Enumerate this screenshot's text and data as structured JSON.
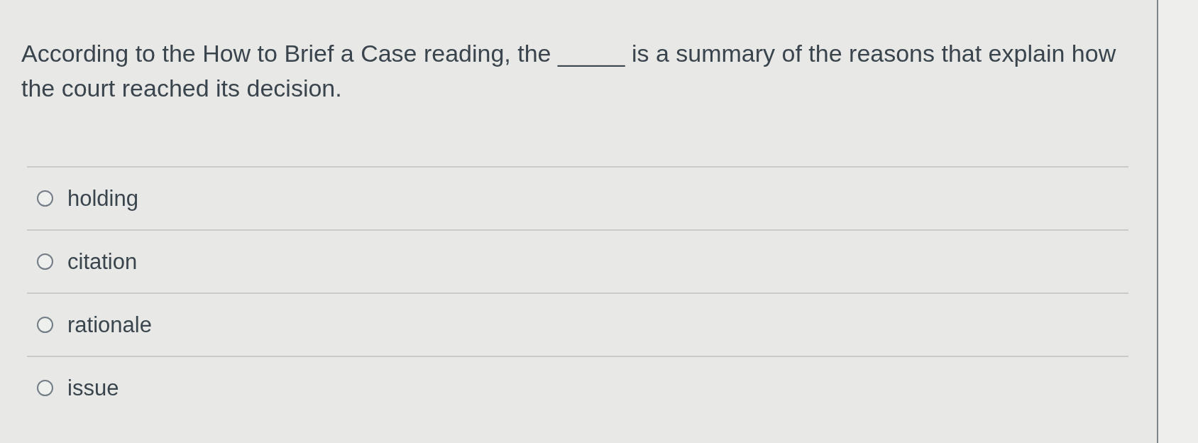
{
  "question": {
    "text": "According to the How to Brief a Case reading, the _____ is a summary of the reasons that explain how the court reached its decision."
  },
  "options": [
    {
      "label": "holding",
      "selected": false
    },
    {
      "label": "citation",
      "selected": false
    },
    {
      "label": "rationale",
      "selected": false
    },
    {
      "label": "issue",
      "selected": false
    }
  ]
}
